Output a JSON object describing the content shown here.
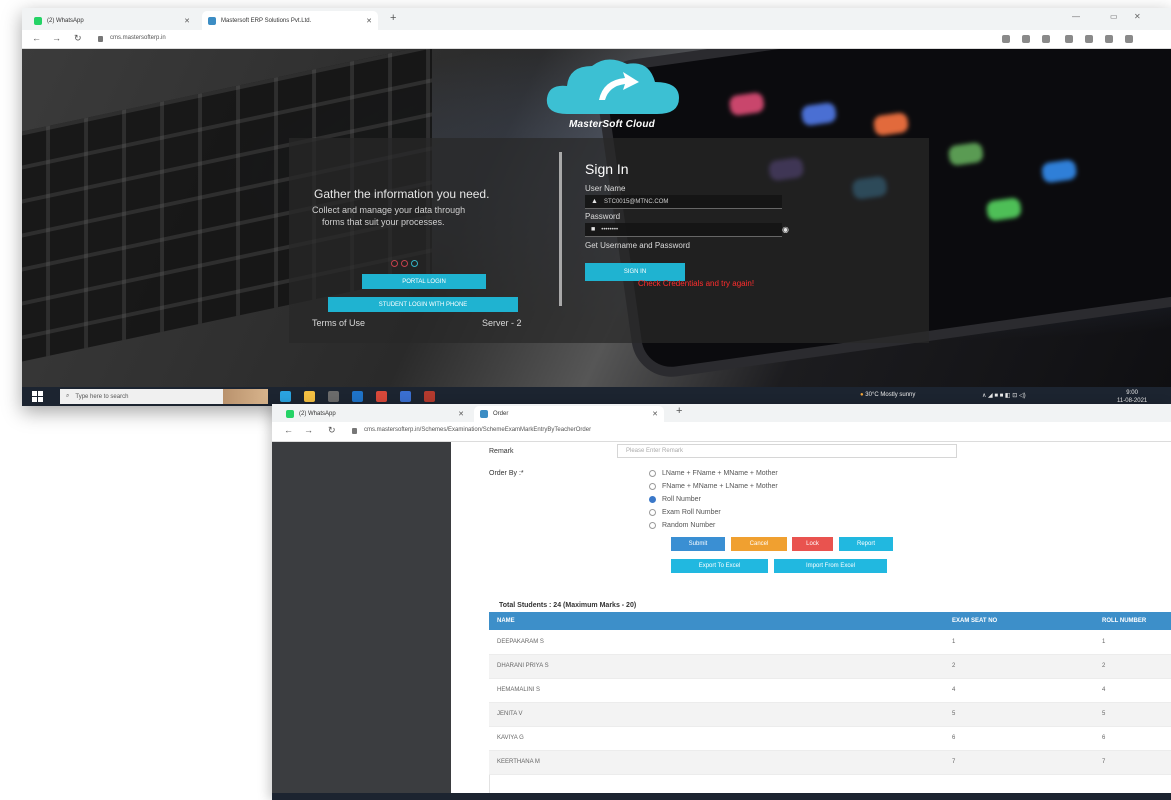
{
  "login_window": {
    "tabs": [
      {
        "label": "(2) WhatsApp",
        "favicon_color": "#25d366"
      },
      {
        "label": "Mastersoft ERP Solutions Pvt.Ltd.",
        "favicon_color": "#3c8dc4"
      }
    ],
    "new_tab": "+",
    "url": "cms.mastersofterp.in",
    "brand": "MasterSoft Cloud",
    "tagline": "Gather the information you need.",
    "tagline_sub": "Collect and manage your data through",
    "tagline_sub2": "forms that suit your processes.",
    "portal_login": "PORTAL LOGIN",
    "student_login": "STUDENT LOGIN WITH PHONE",
    "terms": "Terms of Use",
    "server": "Server - 2",
    "signin_title": "Sign In",
    "username_label": "User Name",
    "username_value": "STC0015@MTNC.COM",
    "password_label": "Password",
    "password_value": "••••••••",
    "forgot": "Get Username and Password",
    "signin_button": "SIGN IN",
    "error": "Check Credentials and try again!",
    "taskbar": {
      "search_placeholder": "Type here to search",
      "weather": "30°C Mostly sunny",
      "time": "9:00",
      "date": "11-08-2021"
    }
  },
  "order_window": {
    "tabs": [
      {
        "label": "(2) WhatsApp",
        "favicon_color": "#25d366"
      },
      {
        "label": "Order",
        "favicon_color": "#3c8dc4"
      }
    ],
    "new_tab": "+",
    "url": "cms.mastersofterp.in/Schemes/Examination/SchemeExamMarkEntryByTeacherOrder",
    "remark_label": "Remark",
    "remark_placeholder": "Please Enter Remark",
    "order_by_label": "Order By :*",
    "order_options": [
      {
        "label": "LName + FName + MName + Mother",
        "selected": false
      },
      {
        "label": "FName + MName + LName + Mother",
        "selected": false
      },
      {
        "label": "Roll Number",
        "selected": true
      },
      {
        "label": "Exam Roll Number",
        "selected": false
      },
      {
        "label": "Random Number",
        "selected": false
      }
    ],
    "buttons": {
      "submit": "Submit",
      "cancel": "Cancel",
      "lock": "Lock",
      "report": "Report",
      "export_excel": "Export To Excel",
      "import_excel": "Import From Excel"
    },
    "button_colors": {
      "primary": "#3a8fd3",
      "warning": "#f0a030",
      "danger": "#e9534f",
      "info": "#21b8e0"
    },
    "total_students": "Total Students : 24 (Maximum Marks - 20)",
    "table": {
      "headers": [
        "NAME",
        "EXAM SEAT NO",
        "ROLL NUMBER"
      ],
      "rows": [
        [
          "DEEPAKARAM S",
          "1",
          "1"
        ],
        [
          "DHARANI PRIYA S",
          "2",
          "2"
        ],
        [
          "HEMAMALINI S",
          "4",
          "4"
        ],
        [
          "JENITA V",
          "5",
          "5"
        ],
        [
          "KAVIYA G",
          "6",
          "6"
        ],
        [
          "KEERTHANA M",
          "7",
          "7"
        ]
      ]
    }
  }
}
